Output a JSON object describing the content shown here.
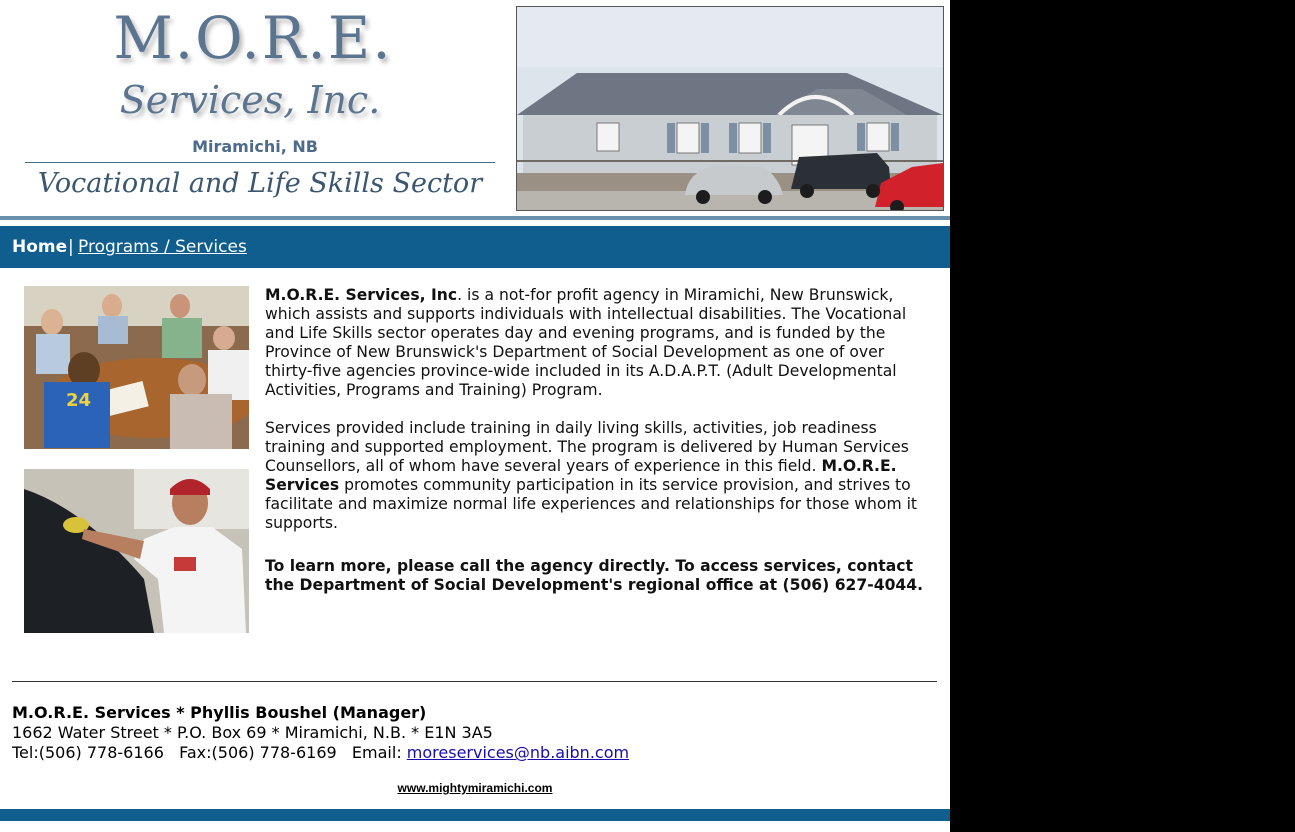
{
  "header": {
    "logo_title": "M.O.R.E.",
    "logo_subtitle": "Services, Inc.",
    "logo_city": "Miramichi, NB",
    "logo_sector": "Vocational and Life Skills Sector"
  },
  "nav": {
    "home": "Home",
    "separator": "|",
    "programs": "Programs / Services"
  },
  "content": {
    "p1_lead": "M.O.R.E. Services, Inc",
    "p1_text": ". is a not-for profit agency in Miramichi, New Brunswick, which assists and supports individuals with intellectual disabilities. The Vocational and Life Skills sector operates day and evening programs, and is funded by the Province of New Brunswick's Department of Social Development as one of over thirty-five agencies province-wide included in its A.D.A.P.T. (Adult Developmental Activities, Programs and Training) Program.",
    "p2_text": "Services provided include training in daily living skills, activities, job readiness training and supported employment. The program is delivered by Human Services Counsellors, all of whom have several years of experience in this field.",
    "p2_lead": "M.O.R.E. Services",
    "p2_text_2": " promotes community participation in its service provision, and strives to facilitate and maximize normal life experiences and relationships for those whom it supports.",
    "p3_text": "To learn more, please call the agency directly. To access services, contact the Department of Social Development's regional office at (506) 627-4044."
  },
  "footer": {
    "name_line": "M.O.R.E. Services * Phyllis Boushel (Manager)",
    "address_line": "1662 Water Street * P.O. Box 69 * Miramichi, N.B. * E1N 3A5",
    "contact_prefix": "Tel:(506) 778-6166   Fax:(506) 778-6169   Email: ",
    "email": "moreservices@nb.aibn.com",
    "site_link": "www.mightymiramichi.com"
  },
  "colors": {
    "nav_background": "#0f5e8e",
    "page_background": "#ffffff",
    "outer_background": "#000000",
    "link": "#1a0dab"
  }
}
